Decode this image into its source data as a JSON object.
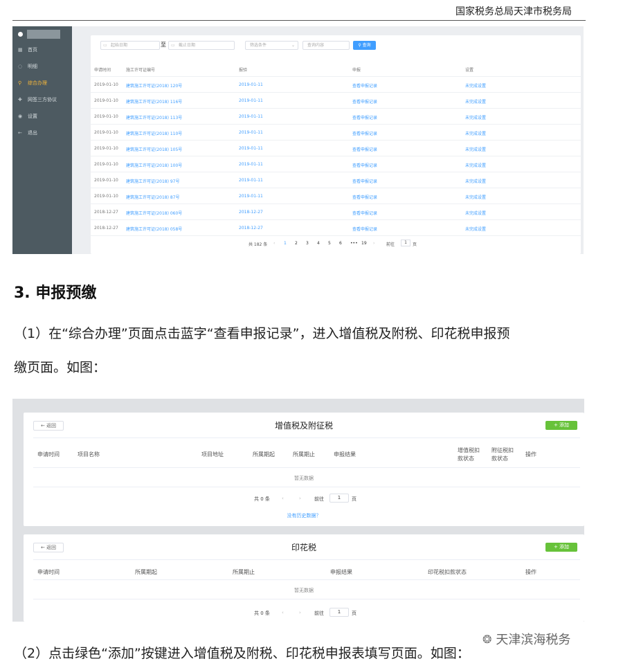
{
  "header": {
    "org": "国家税务总局天津市税务局"
  },
  "shot1": {
    "sidebar": {
      "items": [
        {
          "icon": "grid-icon",
          "glyph": "▦",
          "label": "首页",
          "active": false
        },
        {
          "icon": "circle-icon",
          "glyph": "◌",
          "label": "明细",
          "active": false
        },
        {
          "icon": "search-icon",
          "glyph": "⚲",
          "label": "综合办理",
          "active": true
        },
        {
          "icon": "plus-icon",
          "glyph": "✚",
          "label": "网签三方协议",
          "active": false
        },
        {
          "icon": "gear-icon",
          "glyph": "◉",
          "label": "设置",
          "active": false
        },
        {
          "icon": "exit-icon",
          "glyph": "←",
          "label": "退出",
          "active": false
        }
      ]
    },
    "filters": {
      "start_placeholder": "起始日期",
      "to": "至",
      "end_placeholder": "截止日期",
      "condition_placeholder": "筛选条件",
      "content_placeholder": "查询内容",
      "query_label": "查询"
    },
    "columns": [
      "申请时间",
      "施工许可证编号",
      "报验",
      "申报",
      "设置"
    ],
    "rows": [
      {
        "date": "2019-01-10",
        "permit": "建筑施工许可证(2018) 120号",
        "check": "2019-01-11",
        "declare": "查看申报记录",
        "setting": "未完成设置"
      },
      {
        "date": "2019-01-10",
        "permit": "建筑施工许可证(2018) 116号",
        "check": "2019-01-11",
        "declare": "查看申报记录",
        "setting": "未完成设置"
      },
      {
        "date": "2019-01-10",
        "permit": "建筑施工许可证(2018) 113号",
        "check": "2019-01-11",
        "declare": "查看申报记录",
        "setting": "未完成设置"
      },
      {
        "date": "2019-01-10",
        "permit": "建筑施工许可证(2018) 110号",
        "check": "2019-01-11",
        "declare": "查看申报记录",
        "setting": "未完成设置"
      },
      {
        "date": "2019-01-10",
        "permit": "建筑施工许可证(2018) 105号",
        "check": "2019-01-11",
        "declare": "查看申报记录",
        "setting": "未完成设置"
      },
      {
        "date": "2019-01-10",
        "permit": "建筑施工许可证(2018) 100号",
        "check": "2019-01-11",
        "declare": "查看申报记录",
        "setting": "未完成设置"
      },
      {
        "date": "2019-01-10",
        "permit": "建筑施工许可证(2018) 97号",
        "check": "2019-01-11",
        "declare": "查看申报记录",
        "setting": "未完成设置"
      },
      {
        "date": "2019-01-10",
        "permit": "建筑施工许可证(2018) 87号",
        "check": "2019-01-11",
        "declare": "查看申报记录",
        "setting": "未完成设置"
      },
      {
        "date": "2018-12-27",
        "permit": "建筑施工许可证(2018) 060号",
        "check": "2018-12-27",
        "declare": "查看申报记录",
        "setting": "未完成设置"
      },
      {
        "date": "2018-12-27",
        "permit": "建筑施工许可证(2018) 058号",
        "check": "2018-12-27",
        "declare": "查看申报记录",
        "setting": "未完成设置"
      }
    ],
    "pager": {
      "total": "共 182 条",
      "prev": "‹",
      "pages": [
        "1",
        "2",
        "3",
        "4",
        "5",
        "6",
        "•••",
        "19"
      ],
      "current": "1",
      "next": "›",
      "goto": "前往",
      "goto_value": "1",
      "unit": "页"
    }
  },
  "section": {
    "heading": "3. 申报预缴",
    "para1_line1": "（1）在“综合办理”页面点击蓝字“查看申报记录”，进入增值税及附税、印花税申报预",
    "para1_line2": "缴页面。如图：",
    "para2": "（2）点击绿色“添加”按键进入增值税及附税、印花税申报表填写页面。如图："
  },
  "shot2": {
    "vat": {
      "back": "← 返回",
      "title": "增值税及附征税",
      "add": "+ 添加",
      "columns": [
        "申请时间",
        "项目名称",
        "项目地址",
        "所属期起",
        "所属期止",
        "申报结果",
        "增值税扣款状态",
        "附征税扣款状态",
        "操作"
      ],
      "empty": "暂无数据",
      "pager": {
        "total": "共 0 条",
        "prev": "‹",
        "next": "›",
        "goto": "前往",
        "goto_value": "1",
        "unit": "页"
      },
      "history_link": "没有历史数据？"
    },
    "stamp": {
      "back": "← 返回",
      "title": "印花税",
      "add": "+ 添加",
      "columns": [
        "申请时间",
        "所属期起",
        "所属期止",
        "申报结果",
        "印花税扣款状态",
        "操作"
      ],
      "empty": "暂无数据",
      "pager": {
        "total": "共 0 条",
        "prev": "‹",
        "next": "›",
        "goto": "前往",
        "goto_value": "1",
        "unit": "页"
      }
    }
  },
  "watermark": {
    "text": "天津滨海税务",
    "icon": "wechat-icon"
  }
}
